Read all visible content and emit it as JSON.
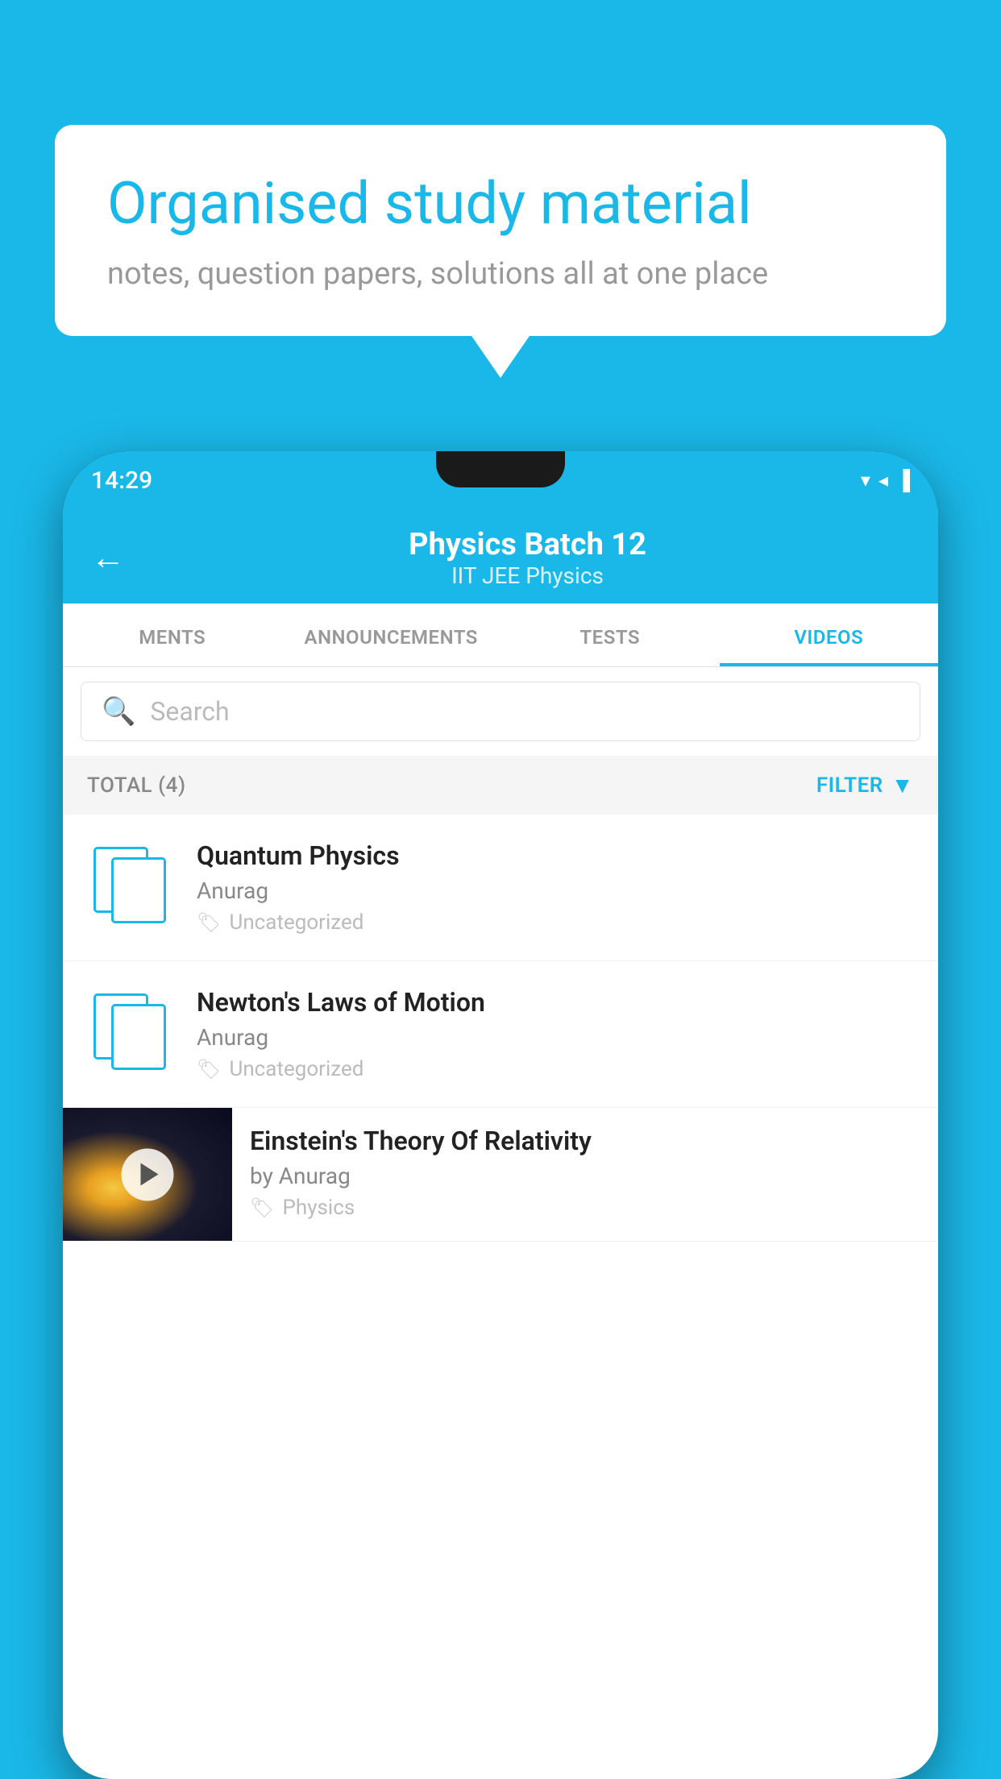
{
  "background_color": "#1ab8e8",
  "speech_bubble": {
    "title": "Organised study material",
    "subtitle": "notes, question papers, solutions all at one place"
  },
  "status_bar": {
    "time": "14:29",
    "icons": "▼◀▌"
  },
  "header": {
    "back_label": "←",
    "title": "Physics Batch 12",
    "subtitle": "IIT JEE   Physics"
  },
  "tabs": [
    {
      "label": "MENTS",
      "active": false
    },
    {
      "label": "ANNOUNCEMENTS",
      "active": false
    },
    {
      "label": "TESTS",
      "active": false
    },
    {
      "label": "VIDEOS",
      "active": true
    }
  ],
  "search": {
    "placeholder": "Search"
  },
  "filter_bar": {
    "total_label": "TOTAL (4)",
    "filter_label": "FILTER"
  },
  "videos": [
    {
      "id": 1,
      "title": "Quantum Physics",
      "author": "Anurag",
      "tag": "Uncategorized",
      "has_thumb": false
    },
    {
      "id": 2,
      "title": "Newton's Laws of Motion",
      "author": "Anurag",
      "tag": "Uncategorized",
      "has_thumb": false
    },
    {
      "id": 3,
      "title": "Einstein's Theory Of Relativity",
      "author": "by Anurag",
      "tag": "Physics",
      "has_thumb": true
    }
  ]
}
